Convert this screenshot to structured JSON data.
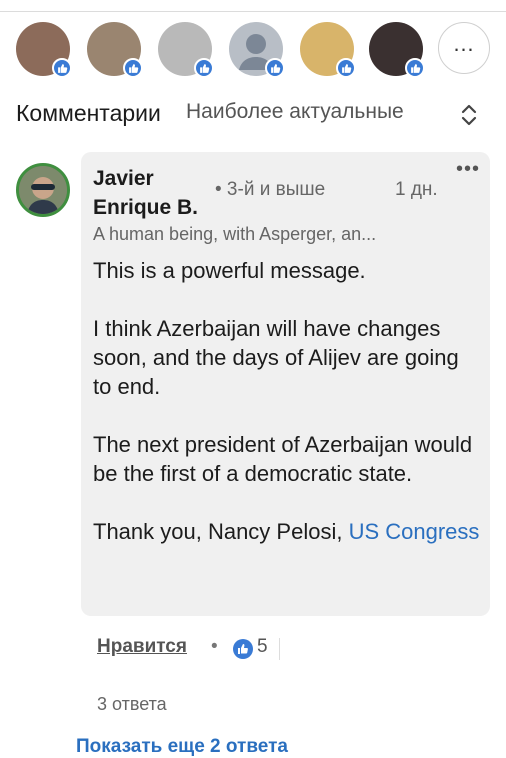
{
  "comments_header": {
    "title": "Комментарии",
    "sort_label": "Наиболее актуальные"
  },
  "reactors": {
    "avatars": [
      {
        "name": "reactor-1",
        "color": "#8c6b5a"
      },
      {
        "name": "reactor-2",
        "color": "#9a8570"
      },
      {
        "name": "reactor-3",
        "color": "#b9b9b9"
      },
      {
        "name": "reactor-4",
        "color": "#b8bec6"
      },
      {
        "name": "reactor-5",
        "color": "#d8b46a"
      },
      {
        "name": "reactor-6",
        "color": "#3a3030"
      }
    ],
    "more_icon": "ellipsis-icon"
  },
  "comment": {
    "author": "Javier Enrique B.",
    "degree": "• 3-й и выше",
    "time": "1 дн.",
    "headline": "A human being, with Asperger, an...",
    "paragraph_1": "This is a powerful message.",
    "paragraph_2": "I think Azerbaijan will have changes soon, and the days of Alijev are going to end.",
    "paragraph_3": "The next president of Azerbaijan would be the first of a democratic state.",
    "paragraph_4_text": "Thank you, Nancy Pelosi, ",
    "paragraph_4_link": "US Congress",
    "like_label": "Нравится",
    "separator": "•",
    "reaction_count": "5",
    "replies_count": "3 ответа",
    "show_more": "Показать еще 2 ответа"
  },
  "colors": {
    "accent": "#2a6fbf",
    "badge": "#3a7bd5",
    "bubble": "#f0f0f0"
  }
}
